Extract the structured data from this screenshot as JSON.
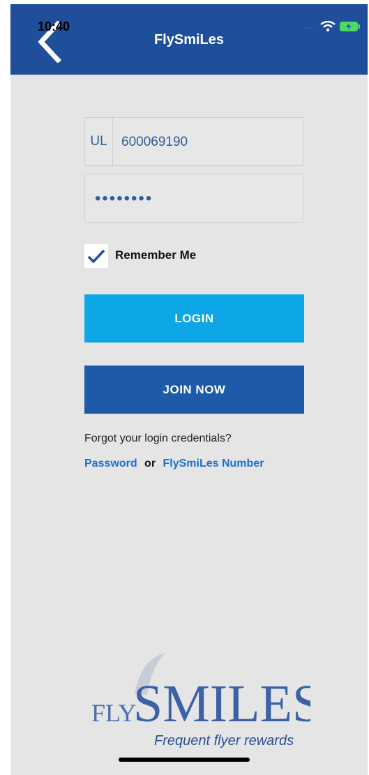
{
  "status_bar": {
    "time": "10:40",
    "signal_icon": "signal-dots-icon",
    "wifi_icon": "wifi-icon",
    "battery_icon": "battery-icon"
  },
  "header": {
    "title": "FlySmiLes",
    "back_icon": "chevron-left-icon"
  },
  "form": {
    "member_prefix": "UL",
    "member_number": "600069190",
    "password_value": "••••••••",
    "remember_label": "Remember Me",
    "remember_checked": true
  },
  "buttons": {
    "login_label": "LOGIN",
    "join_label": "JOIN NOW"
  },
  "forgot": {
    "prompt": "Forgot your login credentials?",
    "password_link": "Password",
    "or_text": "or",
    "number_link": "FlySmiLes Number"
  },
  "logo": {
    "fly": "FLY",
    "smiles": "SMILES",
    "tagline": "Frequent flyer rewards"
  },
  "colors": {
    "navbar": "#1f4e9a",
    "login_button": "#0da6e6",
    "join_button": "#1d5aa8",
    "link": "#1c6fd0",
    "background": "#e5e5e5"
  }
}
